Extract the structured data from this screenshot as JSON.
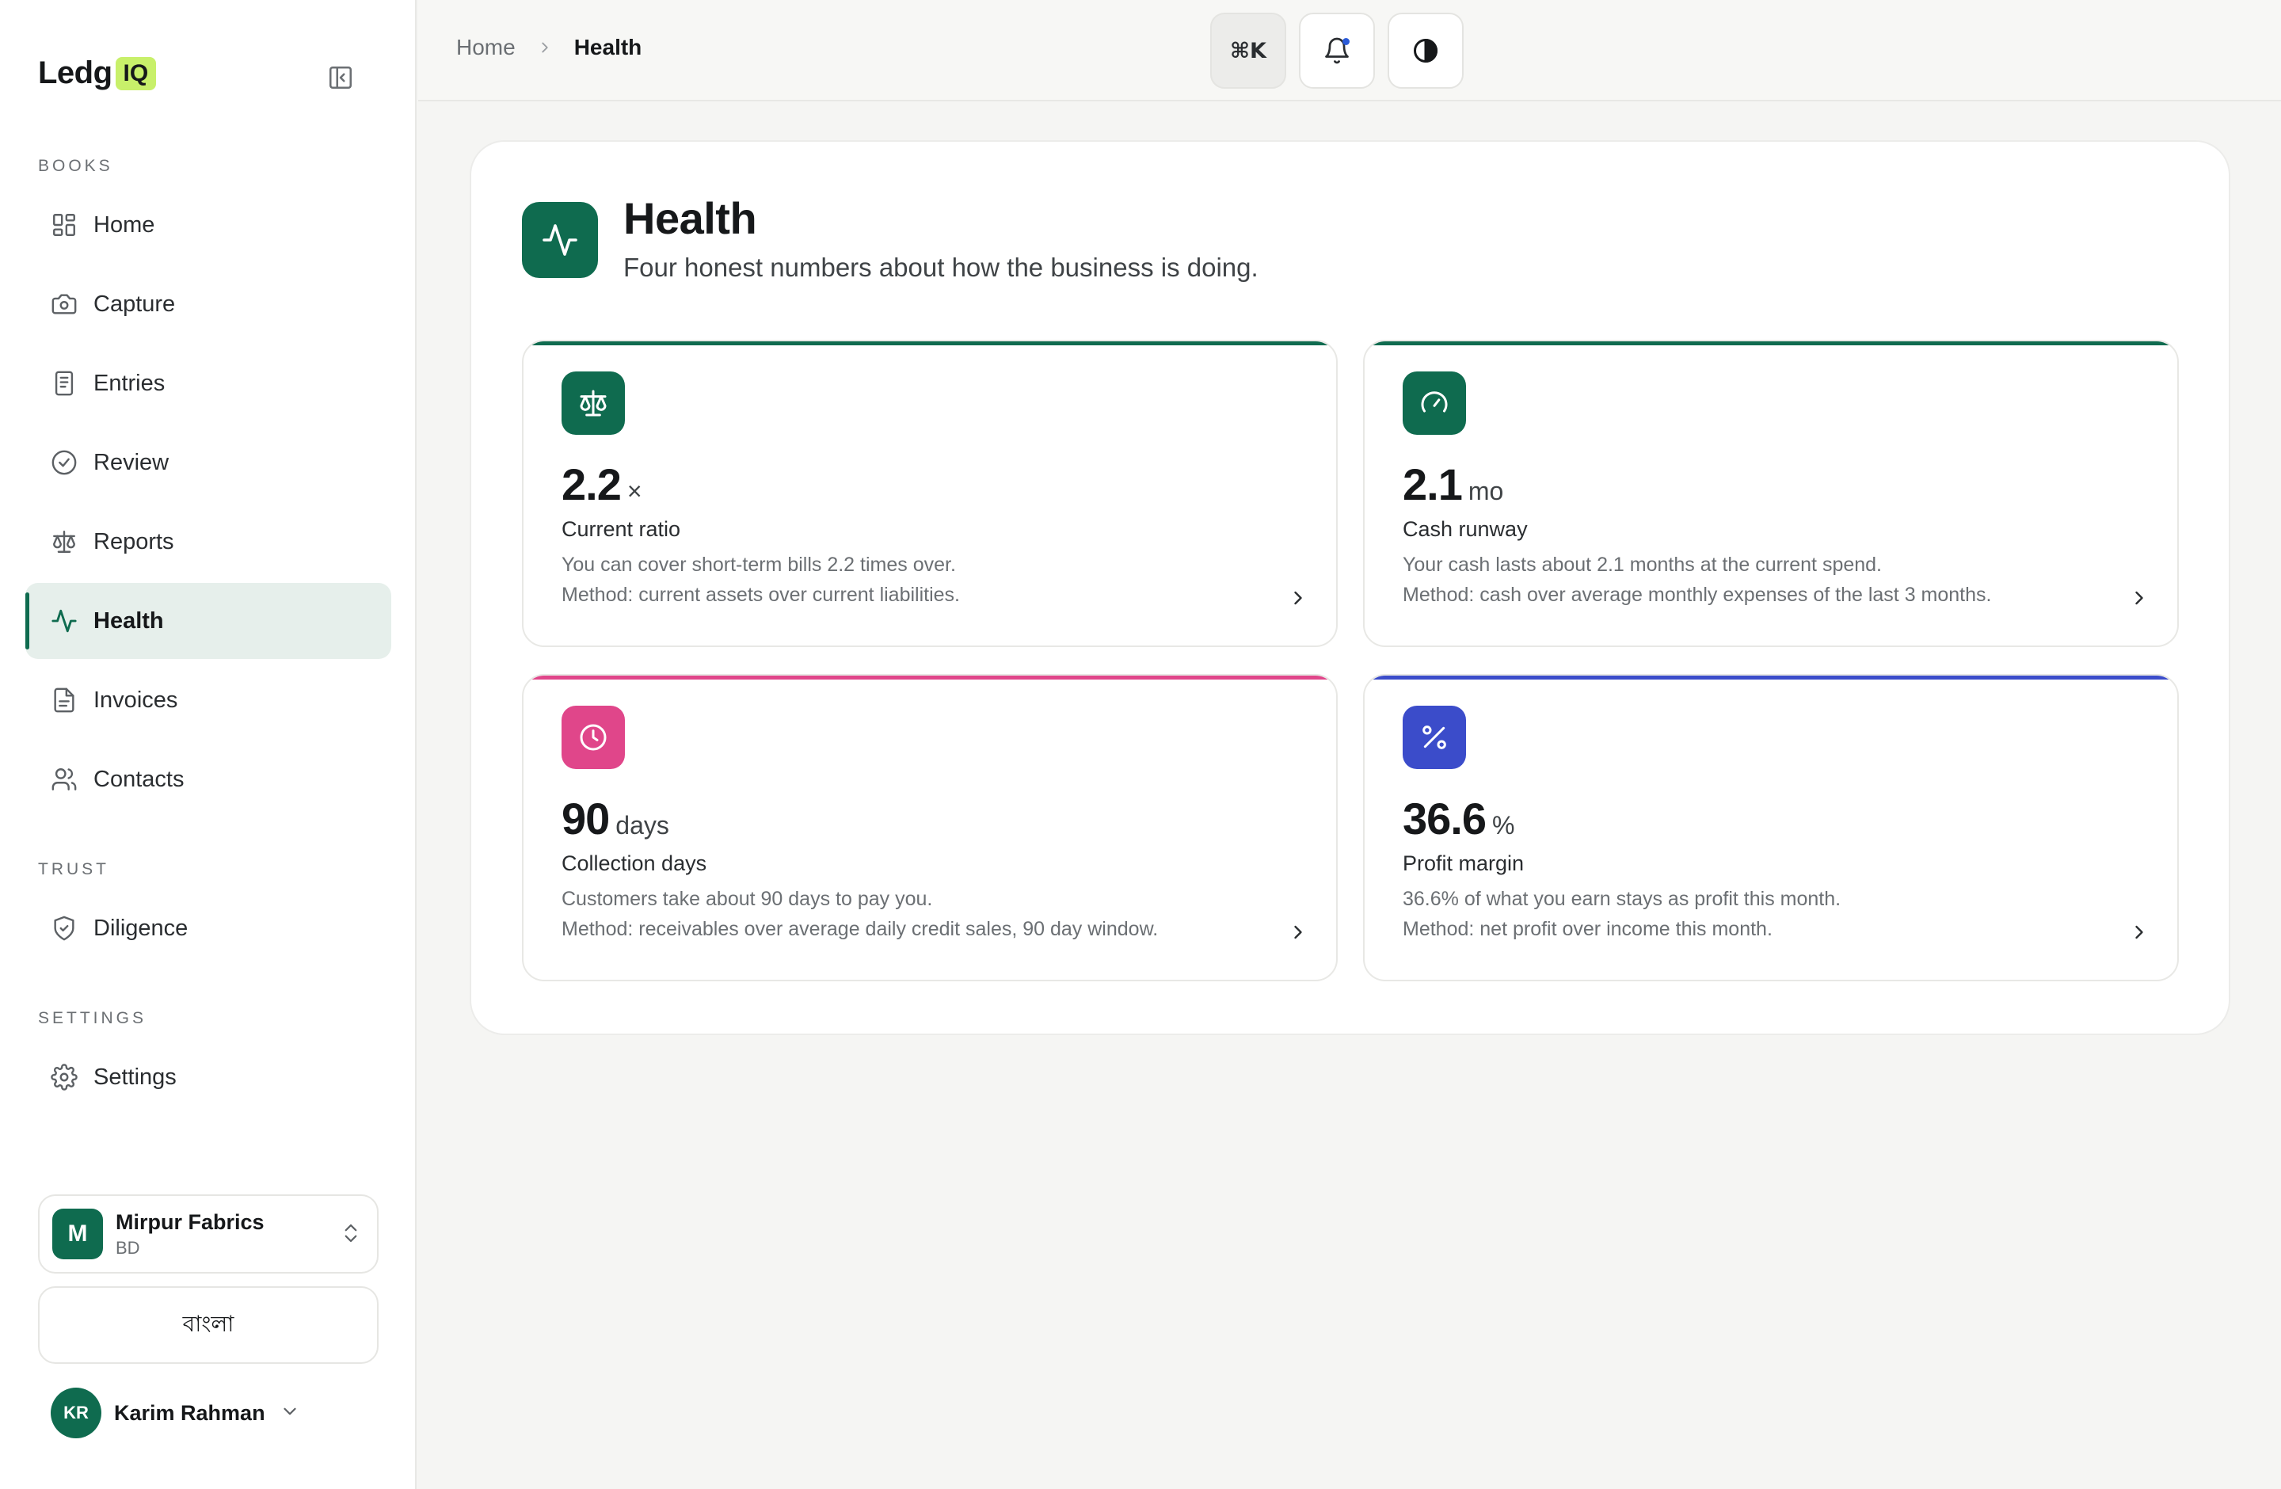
{
  "brand": {
    "name": "Ledg",
    "badge": "IQ"
  },
  "sidebar": {
    "sections": {
      "books": "BOOKS",
      "trust": "TRUST",
      "settings": "SETTINGS"
    },
    "items": [
      {
        "label": "Home",
        "icon": "layout-grid-icon"
      },
      {
        "label": "Capture",
        "icon": "camera-icon"
      },
      {
        "label": "Entries",
        "icon": "receipt-icon"
      },
      {
        "label": "Review",
        "icon": "check-circle-icon"
      },
      {
        "label": "Reports",
        "icon": "scale-icon"
      },
      {
        "label": "Health",
        "icon": "activity-icon",
        "active": true
      },
      {
        "label": "Invoices",
        "icon": "document-icon"
      },
      {
        "label": "Contacts",
        "icon": "users-icon"
      },
      {
        "label": "Diligence",
        "icon": "shield-check-icon"
      },
      {
        "label": "Settings",
        "icon": "gear-icon"
      }
    ],
    "org": {
      "initial": "M",
      "name": "Mirpur Fabrics",
      "country": "BD"
    },
    "language_button": "বাংলা",
    "user": {
      "initials": "KR",
      "name": "Karim Rahman"
    }
  },
  "topbar": {
    "breadcrumb": {
      "home": "Home",
      "current": "Health"
    },
    "command_shortcut": "⌘K"
  },
  "page": {
    "title": "Health",
    "subtitle": "Four honest numbers about how the business is doing."
  },
  "metrics": [
    {
      "value": "2.2",
      "unit": "×",
      "name": "Current ratio",
      "description": "You can cover short-term bills 2.2 times over.",
      "method": "Method: current assets over current liabilities.",
      "color": "#0f6b4f",
      "icon": "scale-icon"
    },
    {
      "value": "2.1",
      "unit": "mo",
      "name": "Cash runway",
      "description": "Your cash lasts about 2.1 months at the current spend.",
      "method": "Method: cash over average monthly expenses of the last 3 months.",
      "color": "#0f6b4f",
      "icon": "gauge-icon"
    },
    {
      "value": "90",
      "unit": "days",
      "name": "Collection days",
      "description": "Customers take about 90 days to pay you.",
      "method": "Method: receivables over average daily credit sales, 90 day window.",
      "color": "#e0468a",
      "icon": "clock-icon"
    },
    {
      "value": "36.6",
      "unit": "%",
      "name": "Profit margin",
      "description": "36.6% of what you earn stays as profit this month.",
      "method": "Method: net profit over income this month.",
      "color": "#3b4cca",
      "icon": "percent-icon"
    }
  ],
  "colors": {
    "primary": "#0f6b4f",
    "active_bg": "#e6efeb",
    "brand_badge": "#c8f06a",
    "pink": "#e0468a",
    "indigo": "#3b4cca",
    "notification_dot": "#2b5bd7"
  }
}
